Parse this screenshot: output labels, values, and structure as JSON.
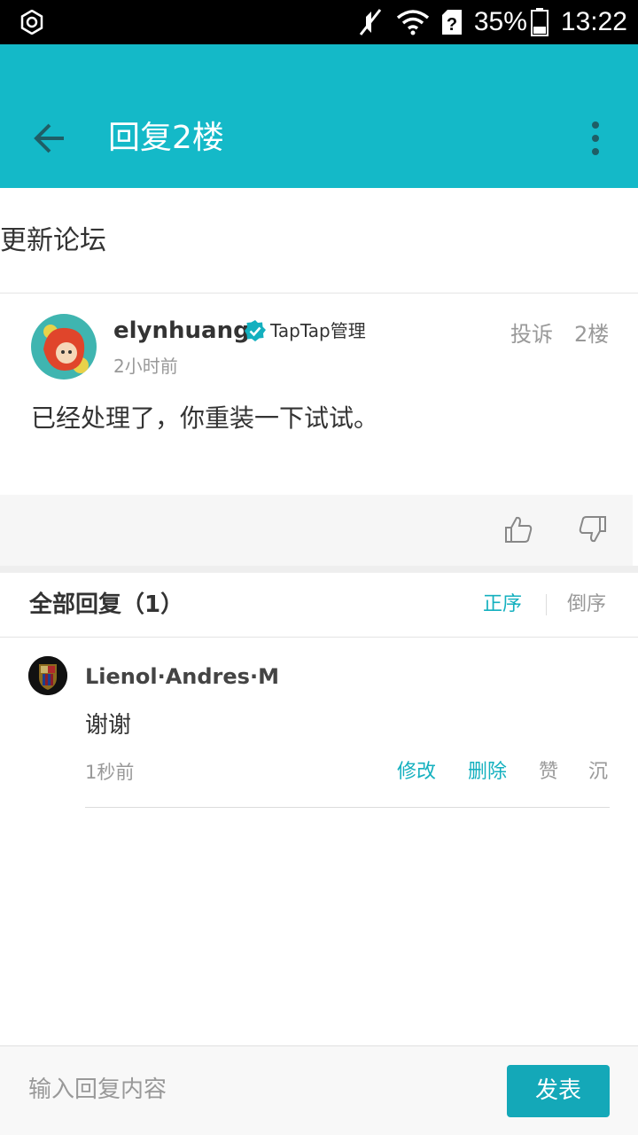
{
  "status_bar": {
    "battery": "35%",
    "time": "13:22"
  },
  "app_bar": {
    "title": "回复2楼"
  },
  "forum": {
    "name": "更新论坛"
  },
  "post": {
    "author": "elynhuang",
    "badge": "TapTap管理",
    "time": "2小时前",
    "report": "投诉",
    "floor": "2楼",
    "content": "已经处理了，你重装一下试试。"
  },
  "replies": {
    "title": "全部回复（1）",
    "sort_asc": "正序",
    "sort_desc": "倒序",
    "items": [
      {
        "author": "Lienol·Andres·M",
        "content": "谢谢",
        "time": "1秒前",
        "edit": "修改",
        "delete": "删除",
        "like": "赞",
        "sink": "沉"
      }
    ]
  },
  "input_bar": {
    "placeholder": "输入回复内容",
    "submit": "发表"
  },
  "colors": {
    "accent": "#14b9c8",
    "link": "#14b0bf"
  }
}
